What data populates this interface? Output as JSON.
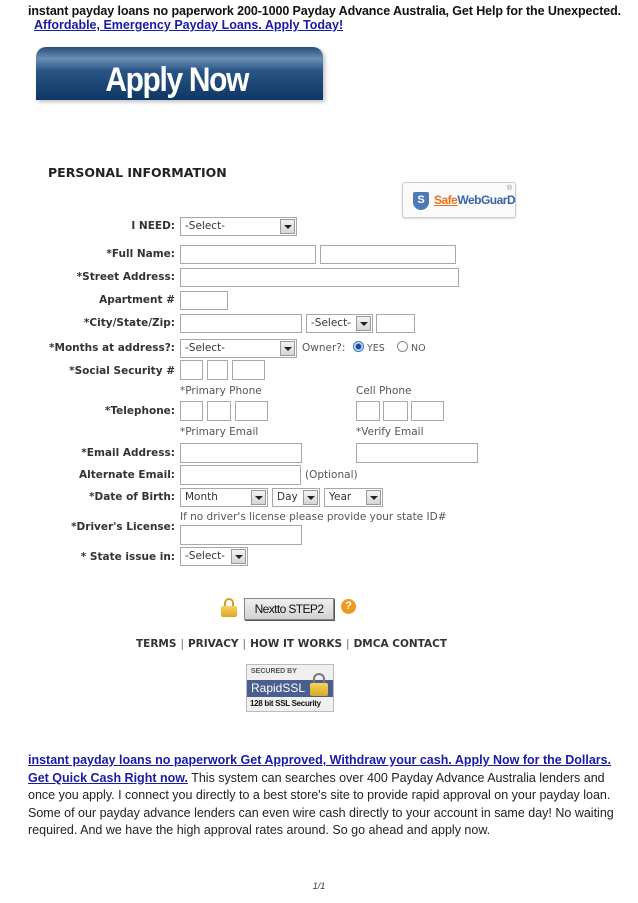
{
  "header": {
    "title": "instant payday loans no paperwork 200-1000 Payday Advance Australia, Get Help for the Unexpected.",
    "link": "Affordable, Emergency Payday Loans. Apply Today!"
  },
  "apply_banner": {
    "label": "Apply Now"
  },
  "form": {
    "section_title": "PERSONAL INFORMATION",
    "badge": {
      "part1": "Safe",
      "part2": "WebGuarD",
      "icon_letter": "S",
      "reg": "®"
    },
    "fields": {
      "i_need": {
        "label": "I NEED:",
        "value": "-Select-"
      },
      "full_name": {
        "label": "*Full Name:"
      },
      "street": {
        "label": "*Street Address:"
      },
      "apartment": {
        "label": "Apartment #"
      },
      "city": {
        "label": "*City/State/Zip:",
        "state_value": "-Select-"
      },
      "months": {
        "label": "*Months at address?:",
        "value": "-Select-",
        "owner_label": "Owner?:",
        "yes": "YES",
        "no": "NO",
        "owner_selected": "YES"
      },
      "ssn": {
        "label": "*Social Security #"
      },
      "telephone": {
        "label": "*Telephone:",
        "primary_caption": "*Primary Phone",
        "cell_caption": "Cell Phone"
      },
      "email": {
        "label": "*Email Address:",
        "primary_caption": "*Primary Email",
        "verify_caption": "*Verify Email"
      },
      "alt_email": {
        "label": "Alternate Email:",
        "note": "(Optional)"
      },
      "dob": {
        "label": "*Date of Birth:",
        "month": "Month",
        "day": "Day",
        "year": "Year"
      },
      "license": {
        "label": "*Driver's License:",
        "hint": "If no driver's license please provide your state ID#"
      },
      "state_issue": {
        "label": "* State issue in:",
        "value": "-Select-"
      }
    },
    "next_button": "Nextto STEP2",
    "help_icon": "?"
  },
  "footer_links": [
    "TERMS",
    "PRIVACY",
    "HOW IT WORKS",
    "DMCA CONTACT"
  ],
  "ssl_badge": {
    "line1": "SECURED BY",
    "line2": "RapidSSL",
    "line3": "128 bit SSL Security"
  },
  "body": {
    "link1": "instant payday loans no paperwork Get Approved, Withdraw your cash. Apply Now for the Dollars.",
    "link2": "Get Quick Cash Right now.",
    "text": " This system can searches over 400 Payday Advance Australia lenders and once you apply. I connect you directly to a best store's site to provide rapid approval on your payday loan. Some of our payday advance lenders can even wire cash directly to your account in same day! No waiting required. And we have the high approval rates around. So go ahead and apply now."
  },
  "page_number": "1/1"
}
